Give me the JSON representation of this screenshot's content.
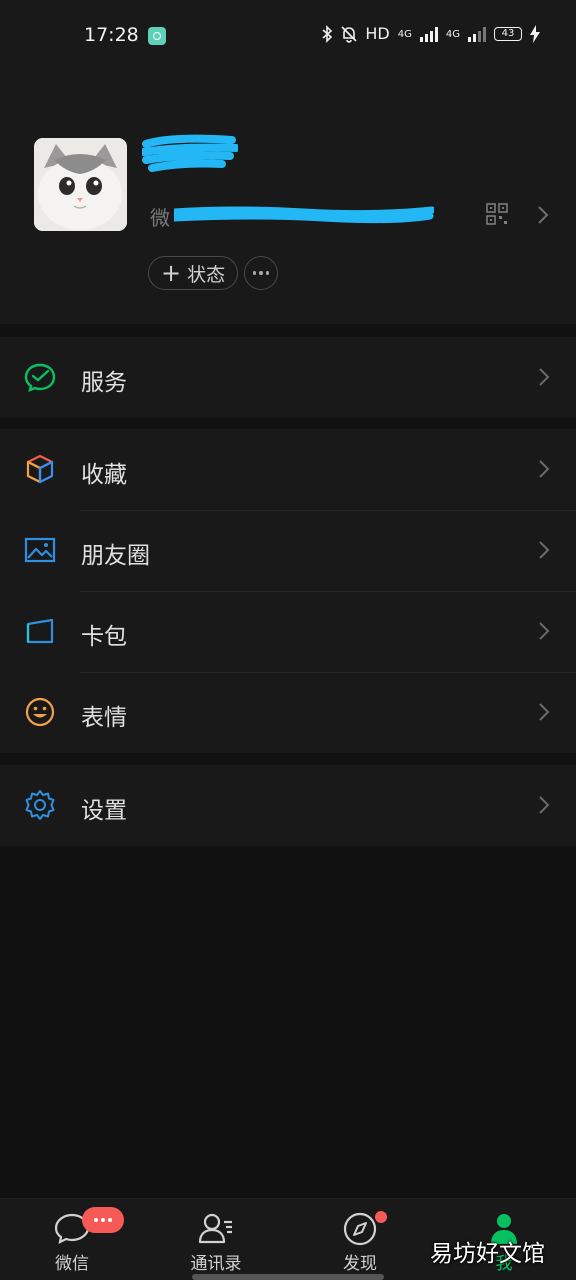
{
  "status_bar": {
    "time": "17:28",
    "hd_label": "HD",
    "net1": "4G",
    "net2": "4G",
    "battery": "43"
  },
  "profile": {
    "id_label": "微",
    "status_button": "状态",
    "status_plus": "+"
  },
  "menu": {
    "services": {
      "label": "服务",
      "icon": "wechat-pay-icon",
      "color": "#07c160"
    },
    "favorites": {
      "label": "收藏",
      "icon": "cube-icon"
    },
    "moments": {
      "label": "朋友圈",
      "icon": "picture-icon",
      "color": "#2f8fe0"
    },
    "cards": {
      "label": "卡包",
      "icon": "wallet-icon",
      "color": "#2f8fe0"
    },
    "stickers": {
      "label": "表情",
      "icon": "smiley-icon",
      "color": "#f0a04a"
    },
    "settings": {
      "label": "设置",
      "icon": "gear-icon",
      "color": "#2f8fe0"
    }
  },
  "tabbar": {
    "chats": "微信",
    "contacts": "通讯录",
    "discover": "发现",
    "me": "我",
    "active_color": "#07c160",
    "badge_color": "#f55a57"
  },
  "watermark": "易坊好文馆"
}
